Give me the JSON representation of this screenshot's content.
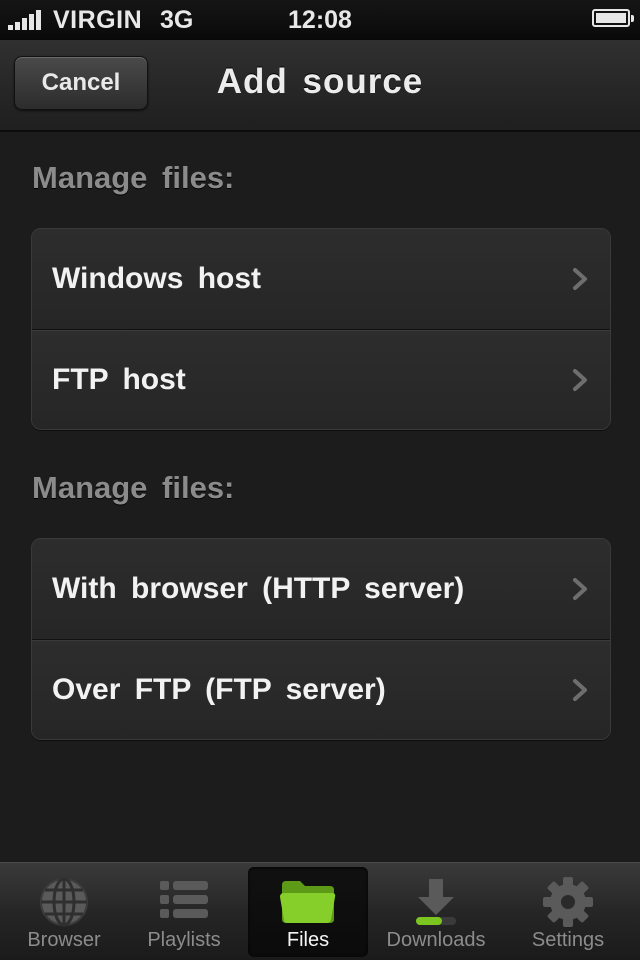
{
  "status_bar": {
    "carrier": "VIRGIN",
    "network": "3G",
    "time": "12:08",
    "signal_bars": 5,
    "battery_level": 1.0
  },
  "nav_bar": {
    "cancel_label": "Cancel",
    "title": "Add source"
  },
  "sections": [
    {
      "header": "Manage files:",
      "items": [
        {
          "label": "Windows host"
        },
        {
          "label": "FTP host"
        }
      ]
    },
    {
      "header": "Manage files:",
      "items": [
        {
          "label": "With browser (HTTP server)"
        },
        {
          "label": "Over FTP (FTP server)"
        }
      ]
    }
  ],
  "tab_bar": {
    "selected": "Files",
    "tabs": [
      {
        "label": "Browser",
        "icon": "globe-icon"
      },
      {
        "label": "Playlists",
        "icon": "list-icon"
      },
      {
        "label": "Files",
        "icon": "folder-icon"
      },
      {
        "label": "Downloads",
        "icon": "download-icon"
      },
      {
        "label": "Settings",
        "icon": "gear-icon"
      }
    ]
  },
  "colors": {
    "accent_green": "#7cc520",
    "background": "#1c1c1c",
    "section_header": "#8b8b8b"
  }
}
